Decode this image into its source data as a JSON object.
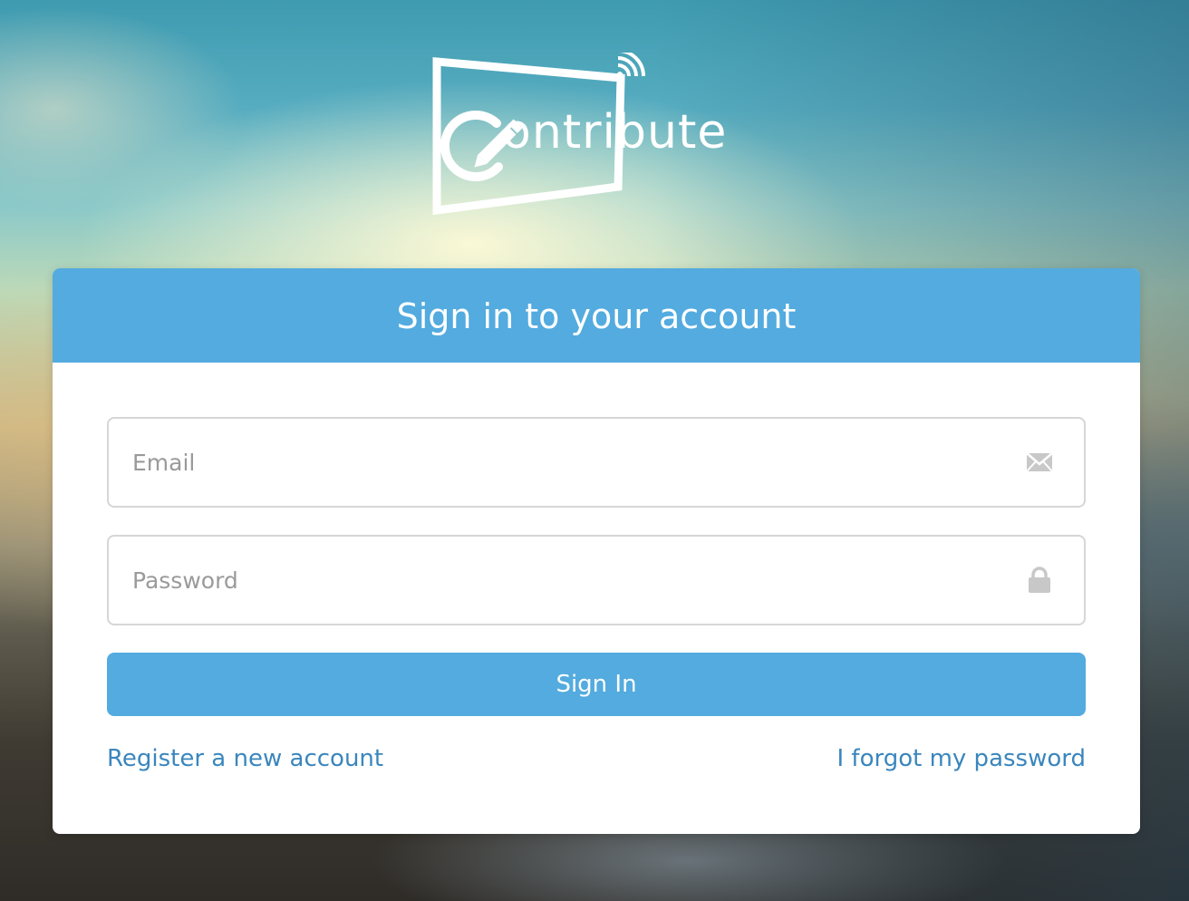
{
  "brand": {
    "logo_text": "ontribute",
    "logo_letter": "C"
  },
  "card": {
    "title": "Sign in to your account",
    "header_color": "#53abdf"
  },
  "form": {
    "email": {
      "placeholder": "Email",
      "value": "",
      "icon": "envelope-icon"
    },
    "password": {
      "placeholder": "Password",
      "value": "",
      "icon": "lock-icon"
    },
    "submit_label": "Sign In"
  },
  "links": {
    "register": "Register a new account",
    "forgot": "I forgot my password"
  },
  "colors": {
    "accent": "#53abdf",
    "link": "#3a86bd",
    "placeholder": "#9a9a9a",
    "border": "#d6d6d6"
  }
}
